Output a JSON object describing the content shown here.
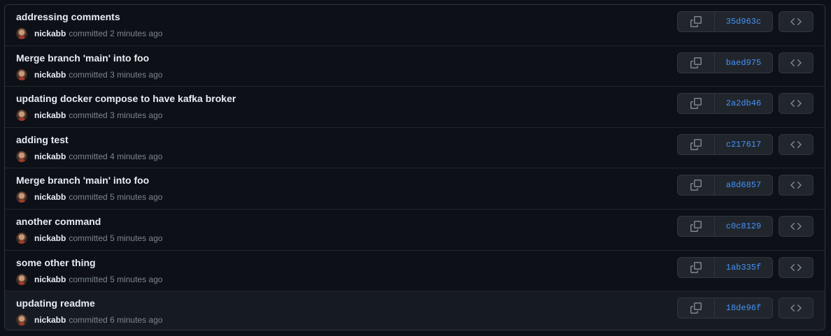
{
  "commits": [
    {
      "title": "addressing comments",
      "author": "nickabb",
      "action": "committed",
      "time": "2 minutes ago",
      "sha": "35d963c"
    },
    {
      "title": "Merge branch 'main' into foo",
      "author": "nickabb",
      "action": "committed",
      "time": "3 minutes ago",
      "sha": "baed975"
    },
    {
      "title": "updating docker compose to have kafka broker",
      "author": "nickabb",
      "action": "committed",
      "time": "3 minutes ago",
      "sha": "2a2db46"
    },
    {
      "title": "adding test",
      "author": "nickabb",
      "action": "committed",
      "time": "4 minutes ago",
      "sha": "c217617"
    },
    {
      "title": "Merge branch 'main' into foo",
      "author": "nickabb",
      "action": "committed",
      "time": "5 minutes ago",
      "sha": "a8d6857"
    },
    {
      "title": "another command",
      "author": "nickabb",
      "action": "committed",
      "time": "5 minutes ago",
      "sha": "c0c8129"
    },
    {
      "title": "some other thing",
      "author": "nickabb",
      "action": "committed",
      "time": "5 minutes ago",
      "sha": "1ab335f"
    },
    {
      "title": "updating readme",
      "author": "nickabb",
      "action": "committed",
      "time": "6 minutes ago",
      "sha": "18de96f"
    }
  ],
  "icons": {
    "copy": "copy-icon",
    "browse": "code-icon"
  },
  "colors": {
    "background": "#0d1117",
    "sha_link": "#4493f8",
    "muted_text": "#7d8590"
  }
}
